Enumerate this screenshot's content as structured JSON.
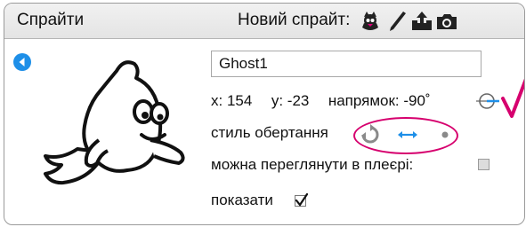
{
  "panel": {
    "title": "Спрайти",
    "new_sprite_label": "Новий спрайт:"
  },
  "toolbar": {
    "icons": [
      "choose-sprite-icon",
      "paint-brush-icon",
      "upload-icon",
      "camera-icon"
    ]
  },
  "sprite": {
    "name": "Ghost1",
    "x_label": "x:",
    "x_value": "154",
    "y_label": "y:",
    "y_value": "-23",
    "direction_label": "напрямок:",
    "direction_value": "-90˚",
    "rotation_style_label": "стиль обертання",
    "rotation_styles": [
      "rotate-icon",
      "left-right-icon",
      "no-rotate-icon"
    ],
    "selected_rotation_style": "left-right",
    "draggable_label": "можна переглянути в плеєрі:",
    "draggable_checked": false,
    "show_label": "показати",
    "show_checked": true
  },
  "colors": {
    "accent_blue": "#1e8fe8",
    "annotation_magenta": "#d6006e"
  }
}
